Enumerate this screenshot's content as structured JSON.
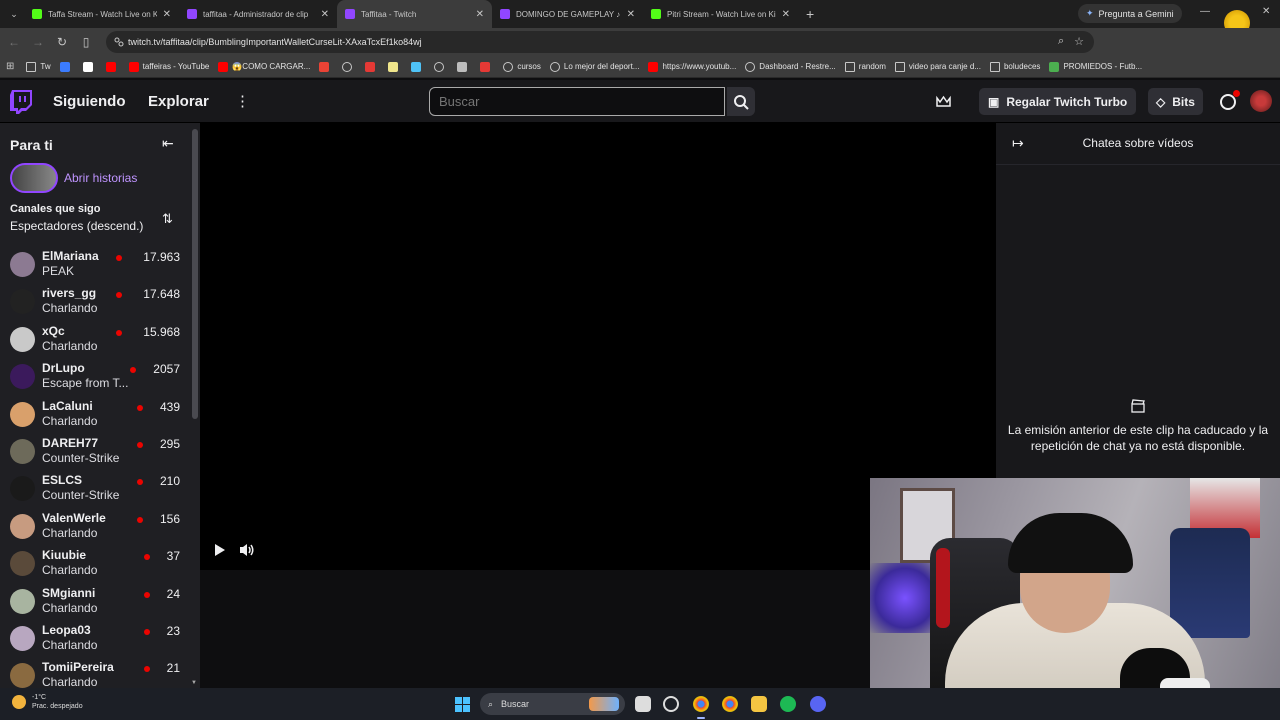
{
  "browser": {
    "tabs": [
      {
        "title": "Taffa Stream - Watch Live on Ki",
        "favicon_color": "#53fc18",
        "active": false
      },
      {
        "title": "taffitaa - Administrador de clip",
        "favicon_color": "#9146ff",
        "active": false
      },
      {
        "title": "Taffitaa - Twitch",
        "favicon_color": "#9146ff",
        "active": true
      },
      {
        "title": "DOMINGO DE GAMEPLAY ♪",
        "favicon_color": "#9146ff",
        "active": false
      },
      {
        "title": "Pitri Stream - Watch Live on Ki",
        "favicon_color": "#53fc18",
        "active": false
      }
    ],
    "gemini_label": "Pregunta a Gemini",
    "url": "twitch.tv/taffitaa/clip/BumblingImportantWalletCurseLit-XAxaTcxEf1ko84wj",
    "bookmarks": [
      {
        "label": "Tw",
        "icon": "folder-icon",
        "color": "#c7c7c7"
      },
      {
        "label": "",
        "icon": "kick-icon",
        "color": "#3b7cff"
      },
      {
        "label": "",
        "icon": "tiktok-icon",
        "color": "#ffffff"
      },
      {
        "label": "",
        "icon": "youtube-icon",
        "color": "#ff0000"
      },
      {
        "label": "taffeiras - YouTube",
        "icon": "youtube-icon",
        "color": "#ff0000"
      },
      {
        "label": "😱COMO CARGAR...",
        "icon": "youtube-icon",
        "color": "#ff0000"
      },
      {
        "label": "",
        "icon": "gmail-icon",
        "color": "#ea4335"
      },
      {
        "label": "",
        "icon": "globe-icon",
        "color": "#c7c7c7"
      },
      {
        "label": "",
        "icon": "app-icon",
        "color": "#e53935"
      },
      {
        "label": "",
        "icon": "app-icon",
        "color": "#f0e68c"
      },
      {
        "label": "",
        "icon": "app-icon",
        "color": "#4fc3f7"
      },
      {
        "label": "",
        "icon": "globe-icon",
        "color": "#c7c7c7"
      },
      {
        "label": "",
        "icon": "app-icon",
        "color": "#bdbdbd"
      },
      {
        "label": "",
        "icon": "app-icon",
        "color": "#e53935"
      },
      {
        "label": "cursos",
        "icon": "globe-icon",
        "color": "#c7c7c7"
      },
      {
        "label": "Lo mejor del deport...",
        "icon": "globe-icon",
        "color": "#c7c7c7"
      },
      {
        "label": "https://www.youtub...",
        "icon": "youtube-icon",
        "color": "#ff0000"
      },
      {
        "label": "Dashboard - Restre...",
        "icon": "globe-icon",
        "color": "#c7c7c7"
      },
      {
        "label": "random",
        "icon": "folder-icon",
        "color": "#c7c7c7"
      },
      {
        "label": "video para canje d...",
        "icon": "folder-icon",
        "color": "#c7c7c7"
      },
      {
        "label": "boludeces",
        "icon": "folder-icon",
        "color": "#c7c7c7"
      },
      {
        "label": "PROMIEDOS - Futb...",
        "icon": "app-icon",
        "color": "#4caf50"
      }
    ]
  },
  "twitch": {
    "nav_following": "Siguiendo",
    "nav_browse": "Explorar",
    "search_placeholder": "Buscar",
    "turbo_label": "Regalar Twitch Turbo",
    "bits_label": "Bits",
    "accent": "#9146ff"
  },
  "sidebar": {
    "title": "Para ti",
    "stories_label": "Abrir historias",
    "followed_heading": "Canales que sigo",
    "sort_label": "Espectadores (descend.)",
    "channels": [
      {
        "name": "ElMariana",
        "game": "PEAK",
        "viewers": "17.963",
        "avatar_color": "#8c7a92"
      },
      {
        "name": "rivers_gg",
        "game": "Charlando",
        "viewers": "17.648",
        "avatar_color": "#222222"
      },
      {
        "name": "xQc",
        "game": "Charlando",
        "viewers": "15.968",
        "avatar_color": "#c9c9c9"
      },
      {
        "name": "DrLupo",
        "game": "Escape from T...",
        "viewers": "2057",
        "avatar_color": "#3b1a5c"
      },
      {
        "name": "LaCaluni",
        "game": "Charlando",
        "viewers": "439",
        "avatar_color": "#d9a06b"
      },
      {
        "name": "DAREH77",
        "game": "Counter-Strike",
        "viewers": "295",
        "avatar_color": "#6d6a5a"
      },
      {
        "name": "ESLCS",
        "game": "Counter-Strike",
        "viewers": "210",
        "avatar_color": "#1a1a1a"
      },
      {
        "name": "ValenWerle",
        "game": "Charlando",
        "viewers": "156",
        "avatar_color": "#c79b80"
      },
      {
        "name": "Kiuubie",
        "game": "Charlando",
        "viewers": "37",
        "avatar_color": "#5a4a3a"
      },
      {
        "name": "SMgianni",
        "game": "Charlando",
        "viewers": "24",
        "avatar_color": "#a8b4a0"
      },
      {
        "name": "Leopa03",
        "game": "Charlando",
        "viewers": "23",
        "avatar_color": "#b8a7c0"
      },
      {
        "name": "TomiiPereira",
        "game": "Charlando",
        "viewers": "21",
        "avatar_color": "#8a6a40"
      }
    ]
  },
  "chat": {
    "title": "Chatea sobre vídeos",
    "message": "La emisión anterior de este clip ha caducado y la repetición de chat ya no está disponible."
  },
  "taskbar": {
    "temperature": "-1°C",
    "weather": "Prac. despejado",
    "search_label": "Buscar"
  }
}
